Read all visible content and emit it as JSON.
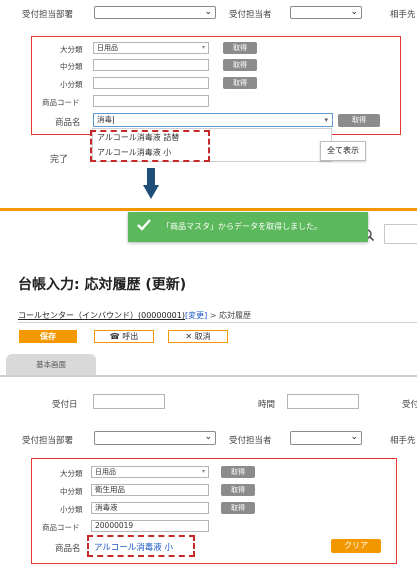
{
  "top": {
    "dept_label": "受付担当部署",
    "staff_label": "受付担当者",
    "sodan_label": "相手先",
    "category_large_label": "大分類",
    "category_large_value": "日用品",
    "category_mid_label": "中分類",
    "category_small_label": "小分類",
    "product_code_label": "商品コード",
    "product_name_label": "商品名",
    "product_name_value": "消毒",
    "acquire_label": "取得",
    "done_label": "完了",
    "suggestions": [
      "アルコール消毒液 詰替",
      "アルコール消毒液 小"
    ],
    "show_all_label": "全て表示"
  },
  "toast": {
    "message": "「商品マスタ」からデータを取得しました。"
  },
  "bottom": {
    "page_title": "台帳入力: 応対履歴 (更新)",
    "breadcrumb_link": "コールセンター（インバウンド）(00000001)",
    "breadcrumb_change": "[変更]",
    "breadcrumb_sep": ">",
    "breadcrumb_current": "応対履歴",
    "save_label": "保存",
    "call_label": "呼出",
    "cancel_label": "取消",
    "tab_basic": "基本画面",
    "received_date_label": "受付日",
    "time_label": "時間",
    "dept_label": "受付担当部署",
    "staff_label": "受付担当者",
    "partner_label": "相手先",
    "category_large_label": "大分類",
    "category_large_value": "日用品",
    "category_mid_label": "中分類",
    "category_mid_value": "衛生用品",
    "category_small_label": "小分類",
    "category_small_value": "消毒液",
    "product_code_label": "商品コード",
    "product_code_value": "20000019",
    "product_name_label": "商品名",
    "product_name_value": "アルコール消毒液 小",
    "acquire_label": "取得",
    "clear_label": "クリア"
  },
  "colors": {
    "accent_orange": "#f39800",
    "toast_green": "#5cb85c",
    "arrow_navy": "#1f4e79",
    "highlight_red": "#e53935",
    "link_blue": "#1a56c4"
  },
  "icons": [
    "chevron-down-icon",
    "check-icon",
    "search-icon",
    "phone-icon",
    "close-icon",
    "down-arrow-icon"
  ]
}
